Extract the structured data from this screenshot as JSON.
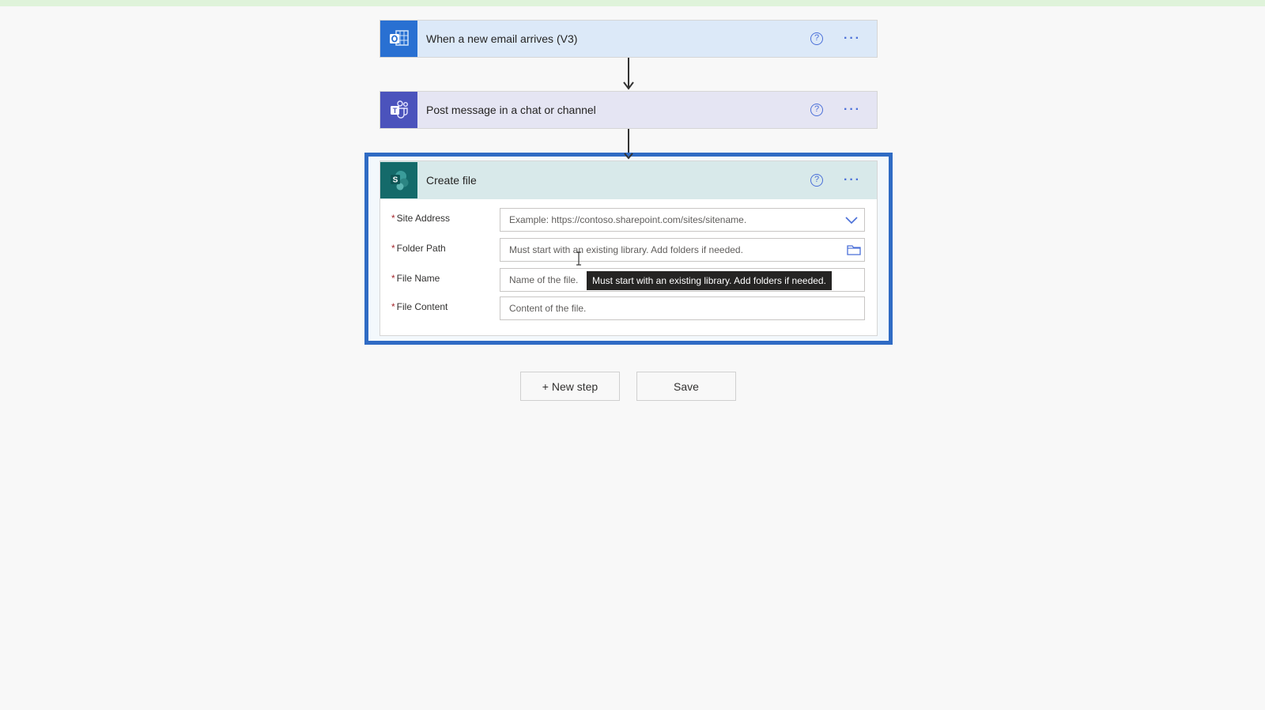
{
  "flow": {
    "steps": [
      {
        "title": "When a new email arrives (V3)",
        "icon": "outlook-icon",
        "help_glyph": "?",
        "more_glyph": "···"
      },
      {
        "title": "Post message in a chat or channel",
        "icon": "teams-icon",
        "help_glyph": "?",
        "more_glyph": "···"
      },
      {
        "title": "Create file",
        "icon": "sharepoint-icon",
        "help_glyph": "?",
        "more_glyph": "···"
      }
    ],
    "create_file": {
      "required_mark": "*",
      "fields": [
        {
          "label": "Site Address",
          "placeholder": "Example: https://contoso.sharepoint.com/sites/sitename.",
          "trailing_icon": "chevron-down-icon"
        },
        {
          "label": "Folder Path",
          "placeholder": "Must start with an existing library. Add folders if needed.",
          "trailing_icon": "folder-icon"
        },
        {
          "label": "File Name",
          "placeholder": "Name of the file."
        },
        {
          "label": "File Content",
          "placeholder": "Content of the file."
        }
      ],
      "tooltip": "Must start with an existing library. Add folders if needed."
    }
  },
  "actions": {
    "new_step_label": "+ New step",
    "save_label": "Save"
  },
  "colors": {
    "selection_border": "#2f6bc4",
    "outlook_brand": "#2970d2",
    "teams_brand": "#4b53bc",
    "sharepoint_brand": "#146a6a",
    "accent": "#4a6fd8"
  }
}
